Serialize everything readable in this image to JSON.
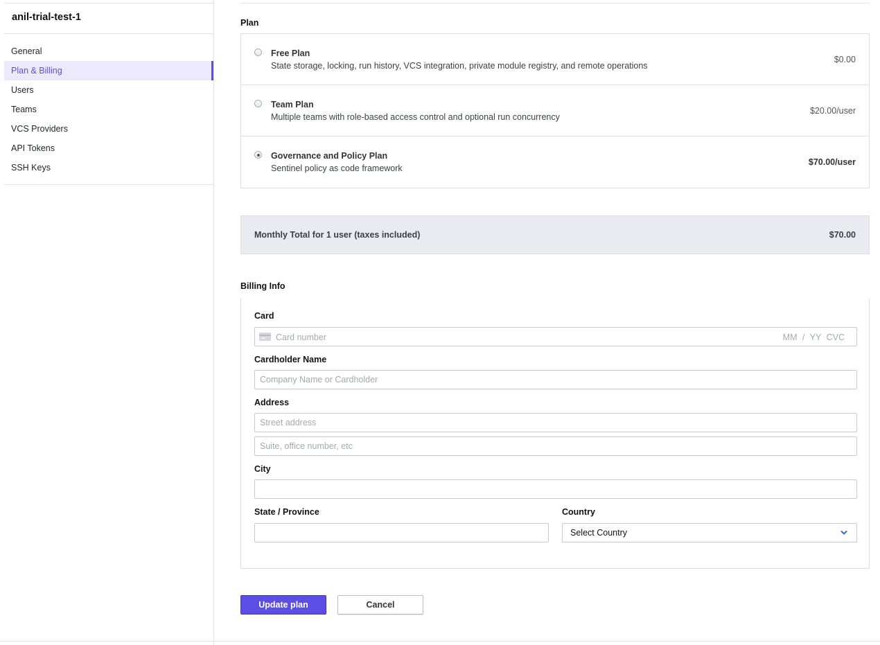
{
  "org": {
    "name": "anil-trial-test-1"
  },
  "sidebar": {
    "items": [
      {
        "label": "General"
      },
      {
        "label": "Plan & Billing",
        "active": true
      },
      {
        "label": "Users"
      },
      {
        "label": "Teams"
      },
      {
        "label": "VCS Providers"
      },
      {
        "label": "API Tokens"
      },
      {
        "label": "SSH Keys"
      }
    ]
  },
  "plan_section": {
    "heading": "Plan",
    "plans": [
      {
        "name": "Free Plan",
        "description": "State storage, locking, run history, VCS integration, private module registry, and remote operations",
        "price": "$0.00",
        "selected": false
      },
      {
        "name": "Team Plan",
        "description": "Multiple teams with role-based access control and optional run concurrency",
        "price": "$20.00/user",
        "selected": false
      },
      {
        "name": "Governance and Policy Plan",
        "description": "Sentinel policy as code framework",
        "price": "$70.00/user",
        "selected": true
      }
    ],
    "total_label": "Monthly Total for 1 user (taxes included)",
    "total_value": "$70.00"
  },
  "billing": {
    "heading": "Billing Info",
    "card_label": "Card",
    "card_placeholder": "Card number",
    "card_expiry_cvc": "MM / YY CVC",
    "cardholder_label": "Cardholder Name",
    "cardholder_placeholder": "Company Name or Cardholder",
    "address_label": "Address",
    "address1_placeholder": "Street address",
    "address2_placeholder": "Suite, office number, etc",
    "city_label": "City",
    "city_value": "",
    "state_label": "State / Province",
    "state_value": "",
    "country_label": "Country",
    "country_value": "Select Country"
  },
  "actions": {
    "update_label": "Update plan",
    "cancel_label": "Cancel"
  },
  "colors": {
    "accent": "#5c4ee5",
    "active_nav_bg": "#ebe9fb",
    "total_bg": "#e8ebef"
  },
  "icons": {
    "card": "credit-card-icon",
    "select": "chevron-down-icon"
  }
}
